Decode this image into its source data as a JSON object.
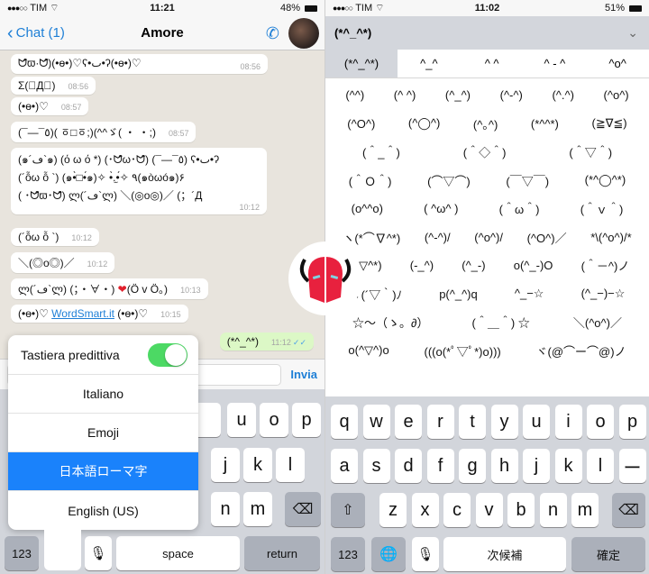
{
  "left": {
    "status": {
      "carrier": "TIM",
      "time": "11:21",
      "battery": "48%"
    },
    "nav": {
      "back_label": "Chat (1)",
      "title": "Amore"
    },
    "messages": [
      {
        "text": "ᗢ̑ϖ·ᗢ̑)(•ɵ•)♡ʕ•ٮ•ʔ(•ɵ•)♡",
        "time": "08:56"
      },
      {
        "text": "Σ(゚Д゚)",
        "time": "08:56"
      },
      {
        "text": "(•ɵ•)♡",
        "time": "08:57"
      },
      {
        "text": "(¯—¯٥)( ㆆ□ㆆ;)(^^ゞ( ・ ・;)",
        "time": "08:57"
      },
      {
        "lines": [
          "(๑´ڡ`๑) (ό ω ό *) (･ᗢ̑ω･ᗢ̑) (¯—¯٥) ʕ•ٮ•ʔ",
          "(´ỗω ỗ `) (๑•̀□•́๑)✧ •̀.̫•́✧ ٩(๑òωó๑)۶",
          "( ･ᗢ̑ϖ･ᗢ̑) ლ(´ڡ`ლ) ＼(◎o◎)／ (；´Д"
        ],
        "time": "10:12"
      },
      {
        "text": "(´ỗω ỗ `)",
        "time": "10:12"
      },
      {
        "text": "＼(◎o◎)／",
        "time": "10:12"
      },
      {
        "text_before": "ლ(´ڡ`ლ)   (；・∀・) ",
        "heart": "❤",
        "text_after": "(Ö v Ö。)",
        "time": "10:13"
      },
      {
        "text_before": "(•ɵ•)♡ ",
        "link": "WordSmart.it",
        "text_after": " (•ɵ•)♡",
        "time": "10:15"
      }
    ],
    "outgoing": {
      "text": "(*^_^*)",
      "time": "11:12",
      "ticks": "✓✓"
    },
    "input": {
      "placeholder": "",
      "send_label": "Invia"
    },
    "language_popup": {
      "predictive_label": "Tastiera predittiva",
      "predictive_on": true,
      "options": [
        "Italiano",
        "Emoji",
        "日本語ローマ字",
        "English (US)"
      ],
      "selected": "日本語ローマ字"
    },
    "keyboard": {
      "row1_visible": [
        "u",
        "i",
        "o",
        "p"
      ],
      "row1_partial": "y",
      "row2_visible": [
        "j",
        "k",
        "l"
      ],
      "row3_visible": [
        "n",
        "m"
      ],
      "numbers_label": "123",
      "space_label": "space",
      "return_label": "return"
    }
  },
  "right": {
    "status": {
      "carrier": "TIM",
      "time": "11:02",
      "battery": "51%"
    },
    "candidate_header": "(*^_^*)",
    "candidate_row": [
      "(*^_^*)",
      "^_^",
      "^ ^",
      "^ - ^",
      "^o^"
    ],
    "emoticon_rows": [
      [
        "(^^)",
        "(^ ^)",
        "(^_^)",
        "(^-^)",
        "(^.^)",
        "(^o^)"
      ],
      [
        "(^O^)",
        "(^◯^)",
        "(^｡^)",
        "(*^^*)",
        "(≧∇≦)"
      ],
      [
        "(＾_＾)",
        "(＾◇＾)",
        "(＾▽＾)"
      ],
      [
        "(＾Ｏ＾)",
        "(⌒▽⌒)",
        "(￣▽￣)",
        "(*^◯^*)"
      ],
      [
        "(o^^o)",
        "( ^ω^ )",
        "(＾ω＾)",
        "(＾ｖ＾)"
      ],
      [
        "ヽ(*⌒∇^*)",
        "(^-^)/",
        "(^o^)/",
        "(^O^)／",
        "*\\(^o^)/*"
      ],
      [
        "(*^▽^*)",
        "(-_^)",
        "(^_-)",
        "o(^_-)O",
        "(＾－^)ノ"
      ],
      [
        "ヽ(´▽｀)ﾉ",
        "p(^_^)q",
        "^_−☆",
        "(^_−)−☆"
      ],
      [
        "☆〜（ゝ。∂）",
        "(＾＿＾) ☆",
        "＼(^o^)／"
      ],
      [
        "o(^▽^)o",
        "(((o(*ﾟ▽ﾟ*)o)))",
        "ヾ(@⌒ー⌒@)ノ"
      ]
    ],
    "keyboard": {
      "row1": [
        "q",
        "w",
        "e",
        "r",
        "t",
        "y",
        "u",
        "i",
        "o",
        "p"
      ],
      "row2": [
        "a",
        "s",
        "d",
        "f",
        "g",
        "h",
        "j",
        "k",
        "l",
        "ー"
      ],
      "row3": [
        "z",
        "x",
        "c",
        "v",
        "b",
        "n",
        "m"
      ],
      "numbers_label": "123",
      "space_label": "次候補",
      "return_label": "確定"
    }
  },
  "colors": {
    "accent": "#1e7fd6",
    "toggle_on": "#4cd964",
    "selected_option": "#1a82fb",
    "logo_red": "#e8213e",
    "outgoing_bubble": "#dcf8c6"
  }
}
